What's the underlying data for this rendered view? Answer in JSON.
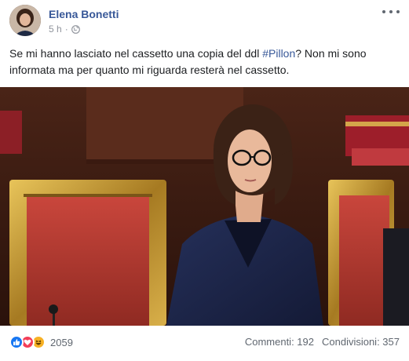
{
  "post": {
    "author": "Elena Bonetti",
    "time": "5 h",
    "separator": "·",
    "privacy_icon": "globe-icon",
    "text_before": "Se mi hanno lasciato nel cassetto una copia del ddl ",
    "hashtag": "#Pillon",
    "text_after": "? Non mi sono informata ma per quanto mi riguarda resterà nel cassetto."
  },
  "footer": {
    "reaction_icons": [
      "like-icon",
      "love-icon",
      "haha-icon"
    ],
    "reaction_count": "2059",
    "comments": "Commenti: 192",
    "shares": "Condivisioni: 357"
  },
  "colors": {
    "link": "#385898",
    "meta": "#90949c",
    "like": "#1877f2",
    "love": "#f33e58",
    "haha": "#f7b125"
  }
}
